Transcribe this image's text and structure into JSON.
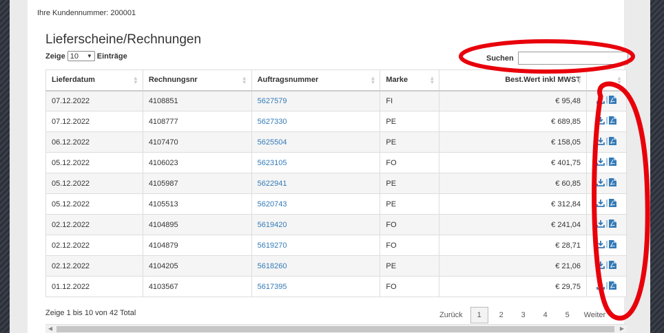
{
  "customer_number_text": "Ihre Kundennummer: 200001",
  "page_title": "Lieferscheine/Rechnungen",
  "length_menu": {
    "prefix": "Zeige",
    "value": "10",
    "suffix": "Einträge"
  },
  "search": {
    "label": "Suchen",
    "value": ""
  },
  "table": {
    "headers": [
      "Lieferdatum",
      "Rechnungsnr",
      "Auftragsnummer",
      "Marke",
      "Best.Wert inkl MWST",
      ""
    ],
    "rows": [
      [
        "07.12.2022",
        "4108851",
        "5627579",
        "FI",
        "€ 95,48"
      ],
      [
        "07.12.2022",
        "4108777",
        "5627330",
        "PE",
        "€ 689,85"
      ],
      [
        "06.12.2022",
        "4107470",
        "5625504",
        "PE",
        "€ 158,05"
      ],
      [
        "05.12.2022",
        "4106023",
        "5623105",
        "FO",
        "€ 401,75"
      ],
      [
        "05.12.2022",
        "4105987",
        "5622941",
        "PE",
        "€ 60,85"
      ],
      [
        "05.12.2022",
        "4105513",
        "5620743",
        "PE",
        "€ 312,84"
      ],
      [
        "02.12.2022",
        "4104895",
        "5619420",
        "FO",
        "€ 241,04"
      ],
      [
        "02.12.2022",
        "4104879",
        "5619270",
        "FO",
        "€ 28,71"
      ],
      [
        "02.12.2022",
        "4104205",
        "5618260",
        "PE",
        "€ 21,06"
      ],
      [
        "01.12.2022",
        "4103567",
        "5617395",
        "FO",
        "€ 29,75"
      ]
    ],
    "action_separator": "|",
    "action_icons": [
      "download-icon",
      "pdf-icon"
    ]
  },
  "info_text": "Zeige 1 bis 10 von 42 Total",
  "pagination": {
    "prev": "Zurück",
    "pages": [
      "1",
      "2",
      "3",
      "4",
      "5"
    ],
    "current": "1",
    "next": "Weiter"
  },
  "annotation_color": "#e8000b",
  "link_color": "#337ab7"
}
